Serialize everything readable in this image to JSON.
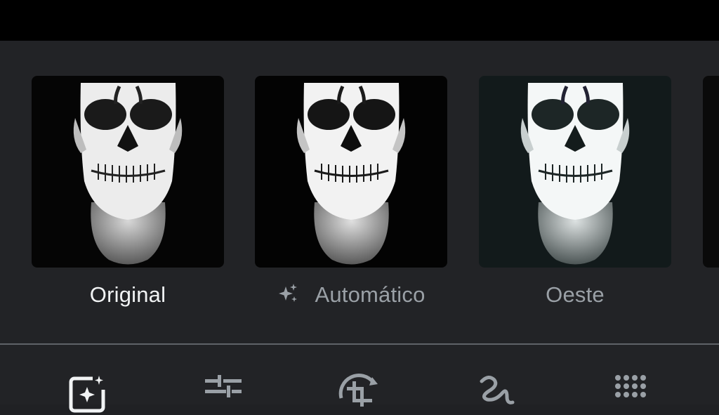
{
  "filters": [
    {
      "label": "Original",
      "selected": true,
      "icon": null
    },
    {
      "label": "Automático",
      "selected": false,
      "icon": "sparkle-icon"
    },
    {
      "label": "Oeste",
      "selected": false,
      "icon": null
    }
  ],
  "toolbar": {
    "tools": [
      {
        "name": "filters-tool",
        "icon": "auto-enhance-icon",
        "active": true
      },
      {
        "name": "adjust-tool",
        "icon": "sliders-icon",
        "active": false
      },
      {
        "name": "crop-tool",
        "icon": "crop-rotate-icon",
        "active": false
      },
      {
        "name": "markup-tool",
        "icon": "markup-squiggle-icon",
        "active": false
      },
      {
        "name": "more-tool",
        "icon": "grid-dots-icon",
        "active": false
      }
    ]
  },
  "colors": {
    "background": "#222326",
    "top_bar": "#000000",
    "label_selected": "#f1f3f4",
    "label_default": "#9aa0a6",
    "divider": "#5f6368"
  }
}
